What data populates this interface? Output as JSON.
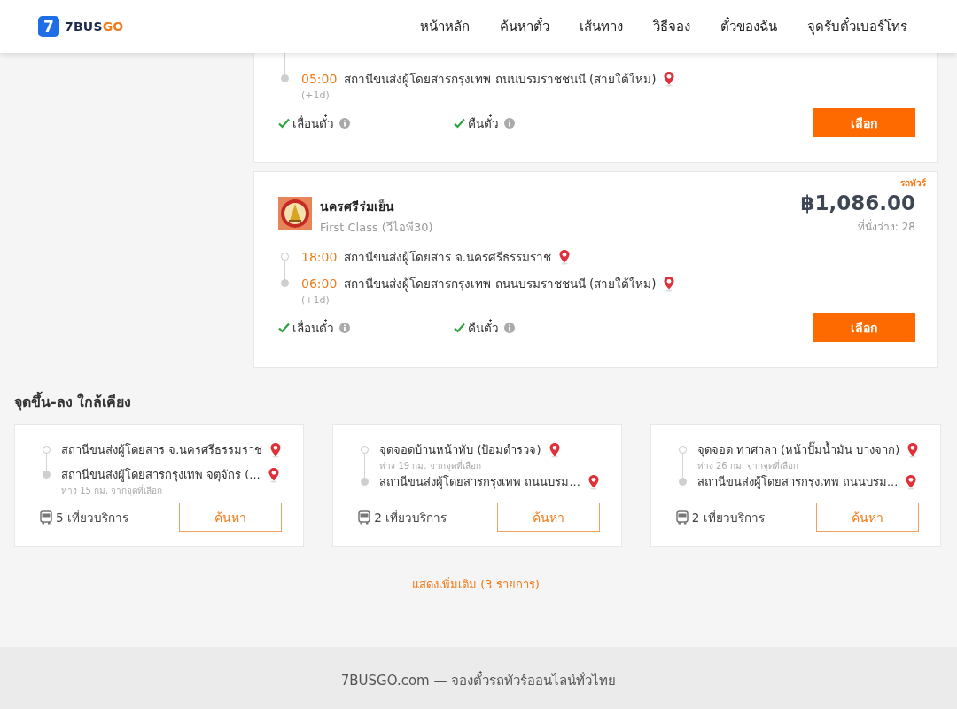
{
  "header": {
    "logo": {
      "mark": "7",
      "brand_main": "7BUS",
      "brand_accent": "GO"
    },
    "nav": [
      {
        "label": "หน้าหลัก"
      },
      {
        "label": "ค้นหาตั๋ว"
      },
      {
        "label": "เส้นทาง"
      },
      {
        "label": "วิธีจอง"
      },
      {
        "label": "ตั๋วของฉัน"
      },
      {
        "label": "จุดรับตั๋วเบอร์โทร"
      }
    ]
  },
  "trips": [
    {
      "cut_top": true,
      "stops": [
        {
          "kind": "arrival",
          "time": "05:00",
          "place": "สถานีขนส่งผู้โดยสารกรุงเทพ ถนนบรมราชชนนี (สายใต้ใหม่)",
          "day_offset": "(+1d)"
        }
      ],
      "features": [
        {
          "label": "เลื่อนตั๋ว",
          "available": true
        },
        {
          "label": "คืนตั๋ว",
          "available": true
        }
      ],
      "button": "เลือก"
    },
    {
      "cut_top": false,
      "tag": "รถทัวร์",
      "operator": "นครศรีร่มเย็น",
      "bus_class": "First Class (วีไอพี30)",
      "price": "฿1,086.00",
      "seats": "ที่นั่งว่าง: 28",
      "stops": [
        {
          "kind": "departure",
          "time": "18:00",
          "place": "สถานีขนส่งผู้โดยสาร จ.นครศรีธรรมราช"
        },
        {
          "kind": "arrival",
          "time": "06:00",
          "place": "สถานีขนส่งผู้โดยสารกรุงเทพ ถนนบรมราชชนนี (สายใต้ใหม่)",
          "day_offset": "(+1d)"
        }
      ],
      "features": [
        {
          "label": "เลื่อนตั๋ว",
          "available": true
        },
        {
          "label": "คืนตั๋ว",
          "available": true
        }
      ],
      "button": "เลือก"
    }
  ],
  "nearby": {
    "title": "จุดขึ้น-ลง ใกล้เคียง",
    "items": [
      {
        "stops": [
          {
            "kind": "departure",
            "place": "สถานีขนส่งผู้โดยสาร จ.นครศรีธรรมราช"
          },
          {
            "kind": "arrival",
            "place": "สถานีขนส่งผู้โดยสารกรุงเทพ จตุจักร (...",
            "distance": "ห่าง 15 กม. จากจุดที่เลือก"
          }
        ],
        "trips": "5 เที่ยวบริการ",
        "button": "ค้นหา"
      },
      {
        "stops": [
          {
            "kind": "departure",
            "place": "จุดจอดบ้านหน้าทับ (ป้อมตำรวจ)",
            "distance": "ห่าง 19 กม. จากจุดที่เลือก"
          },
          {
            "kind": "arrival",
            "place": "สถานีขนส่งผู้โดยสารกรุงเทพ ถนนบรม..."
          }
        ],
        "trips": "2 เที่ยวบริการ",
        "button": "ค้นหา"
      },
      {
        "stops": [
          {
            "kind": "departure",
            "place": "จุดจอด ท่าศาลา (หน้าปั๊มน้ำมัน บางจาก)",
            "distance": "ห่าง 26 กม. จากจุดที่เลือก"
          },
          {
            "kind": "arrival",
            "place": "สถานีขนส่งผู้โดยสารกรุงเทพ ถนนบรม..."
          }
        ],
        "trips": "2 เที่ยวบริการ",
        "button": "ค้นหา"
      }
    ],
    "show_more": "แสดงเพิ่มเติม (3 รายการ)"
  },
  "footer": {
    "text": "7BUSGO.com — จองตั๋วรถทัวร์ออนไลน์ทั่วไทย"
  }
}
